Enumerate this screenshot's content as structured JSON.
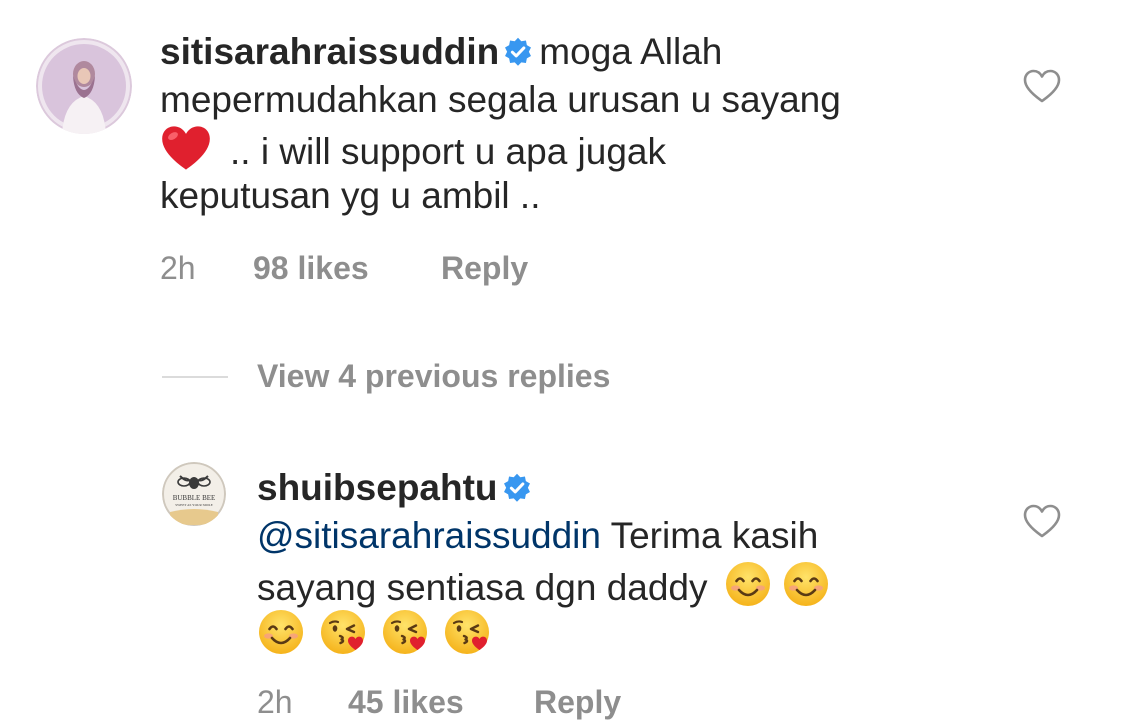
{
  "comment": {
    "username": "sitisarahraissuddin",
    "text_line1": "moga Allah",
    "text_line2": "mepermudahkan segala urusan u sayang",
    "text_line3": ".. i will support u apa jugak",
    "text_line4": "keputusan yg u ambil ..",
    "time": "2h",
    "likes": "98 likes",
    "reply_label": "Reply"
  },
  "view_replies_label": "View 4 previous replies",
  "reply": {
    "username": "shuibsepahtu",
    "mention": "@sitisarahraissuddin",
    "text_line1": " Terima kasih",
    "text_line2": "sayang sentiasa dgn daddy",
    "avatar_text_top": "BUBBLE BEE",
    "avatar_text_bottom": "SWEET AS YOUR SMILE",
    "time": "2h",
    "likes": "45 likes",
    "reply_label": "Reply"
  },
  "icons": {
    "verified": "verified-badge-icon",
    "heart": "red-heart-emoji",
    "smile": "smiling-face-emoji",
    "kiss": "face-blowing-kiss-emoji",
    "like": "heart-outline-icon"
  },
  "colors": {
    "text": "#262626",
    "secondary": "#8e8e8e",
    "verified": "#3897f0",
    "mention": "#003569"
  }
}
